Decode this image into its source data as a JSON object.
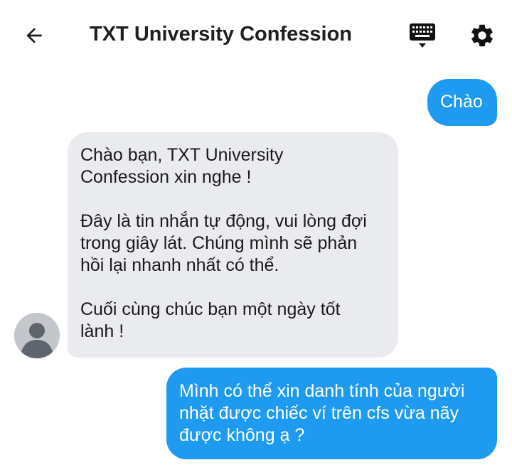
{
  "header": {
    "title": "TXT University Confession",
    "back_icon": "arrow-left-icon",
    "keyboard_icon": "keyboard-icon",
    "settings_icon": "gear-icon"
  },
  "messages": [
    {
      "sender": "me",
      "text": "Chào"
    },
    {
      "sender": "page",
      "text": "Chào bạn, TXT University\nConfession xin nghe !\n\nĐây là tin nhắn tự động, vui lòng đợi\ntrong giây lát. Chúng mình sẽ phản\nhồi lại nhanh nhất có thể.\n\nCuối cùng chúc bạn một ngày tốt\nlành !"
    },
    {
      "sender": "me",
      "text": "Mình có thể xin danh tính của người\nnhặt được chiếc ví trên cfs vừa nãy\nđược không ạ ?"
    }
  ],
  "colors": {
    "outgoing_bubble": "#1e9bf0",
    "incoming_bubble": "#e9ebee",
    "avatar": "#c3c7cc"
  }
}
